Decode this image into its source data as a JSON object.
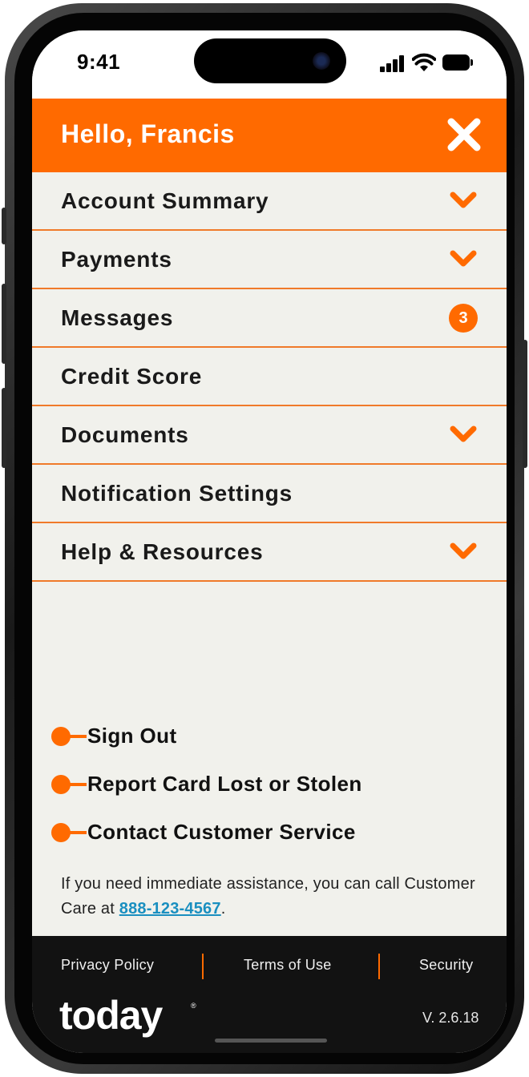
{
  "status_bar": {
    "time": "9:41"
  },
  "header": {
    "greeting": "Hello, Francis",
    "close_icon": "close-icon"
  },
  "menu": {
    "items": [
      {
        "label": "Account Summary",
        "trailing": "chevron-down-icon"
      },
      {
        "label": "Payments",
        "trailing": "chevron-down-icon"
      },
      {
        "label": "Messages",
        "trailing": "badge",
        "badge": "3"
      },
      {
        "label": "Credit Score",
        "trailing": "none"
      },
      {
        "label": "Documents",
        "trailing": "chevron-down-icon"
      },
      {
        "label": "Notification Settings",
        "trailing": "none"
      },
      {
        "label": "Help & Resources",
        "trailing": "chevron-down-icon"
      }
    ]
  },
  "links": [
    {
      "label": "Sign Out"
    },
    {
      "label": "Report Card Lost or Stolen"
    },
    {
      "label": "Contact Customer Service"
    }
  ],
  "assistance": {
    "text_before": "If you need immediate assistance, you can call Customer Care at ",
    "phone": "888-123-4567",
    "text_after": "."
  },
  "footer": {
    "links": [
      "Privacy Policy",
      "Terms of Use",
      "Security"
    ],
    "logo": "today",
    "version": "V. 2.6.18"
  },
  "colors": {
    "accent": "#ff6a00",
    "menu_bg": "#f1f1ec",
    "footer_bg": "#121212",
    "link": "#1a8fc0"
  }
}
